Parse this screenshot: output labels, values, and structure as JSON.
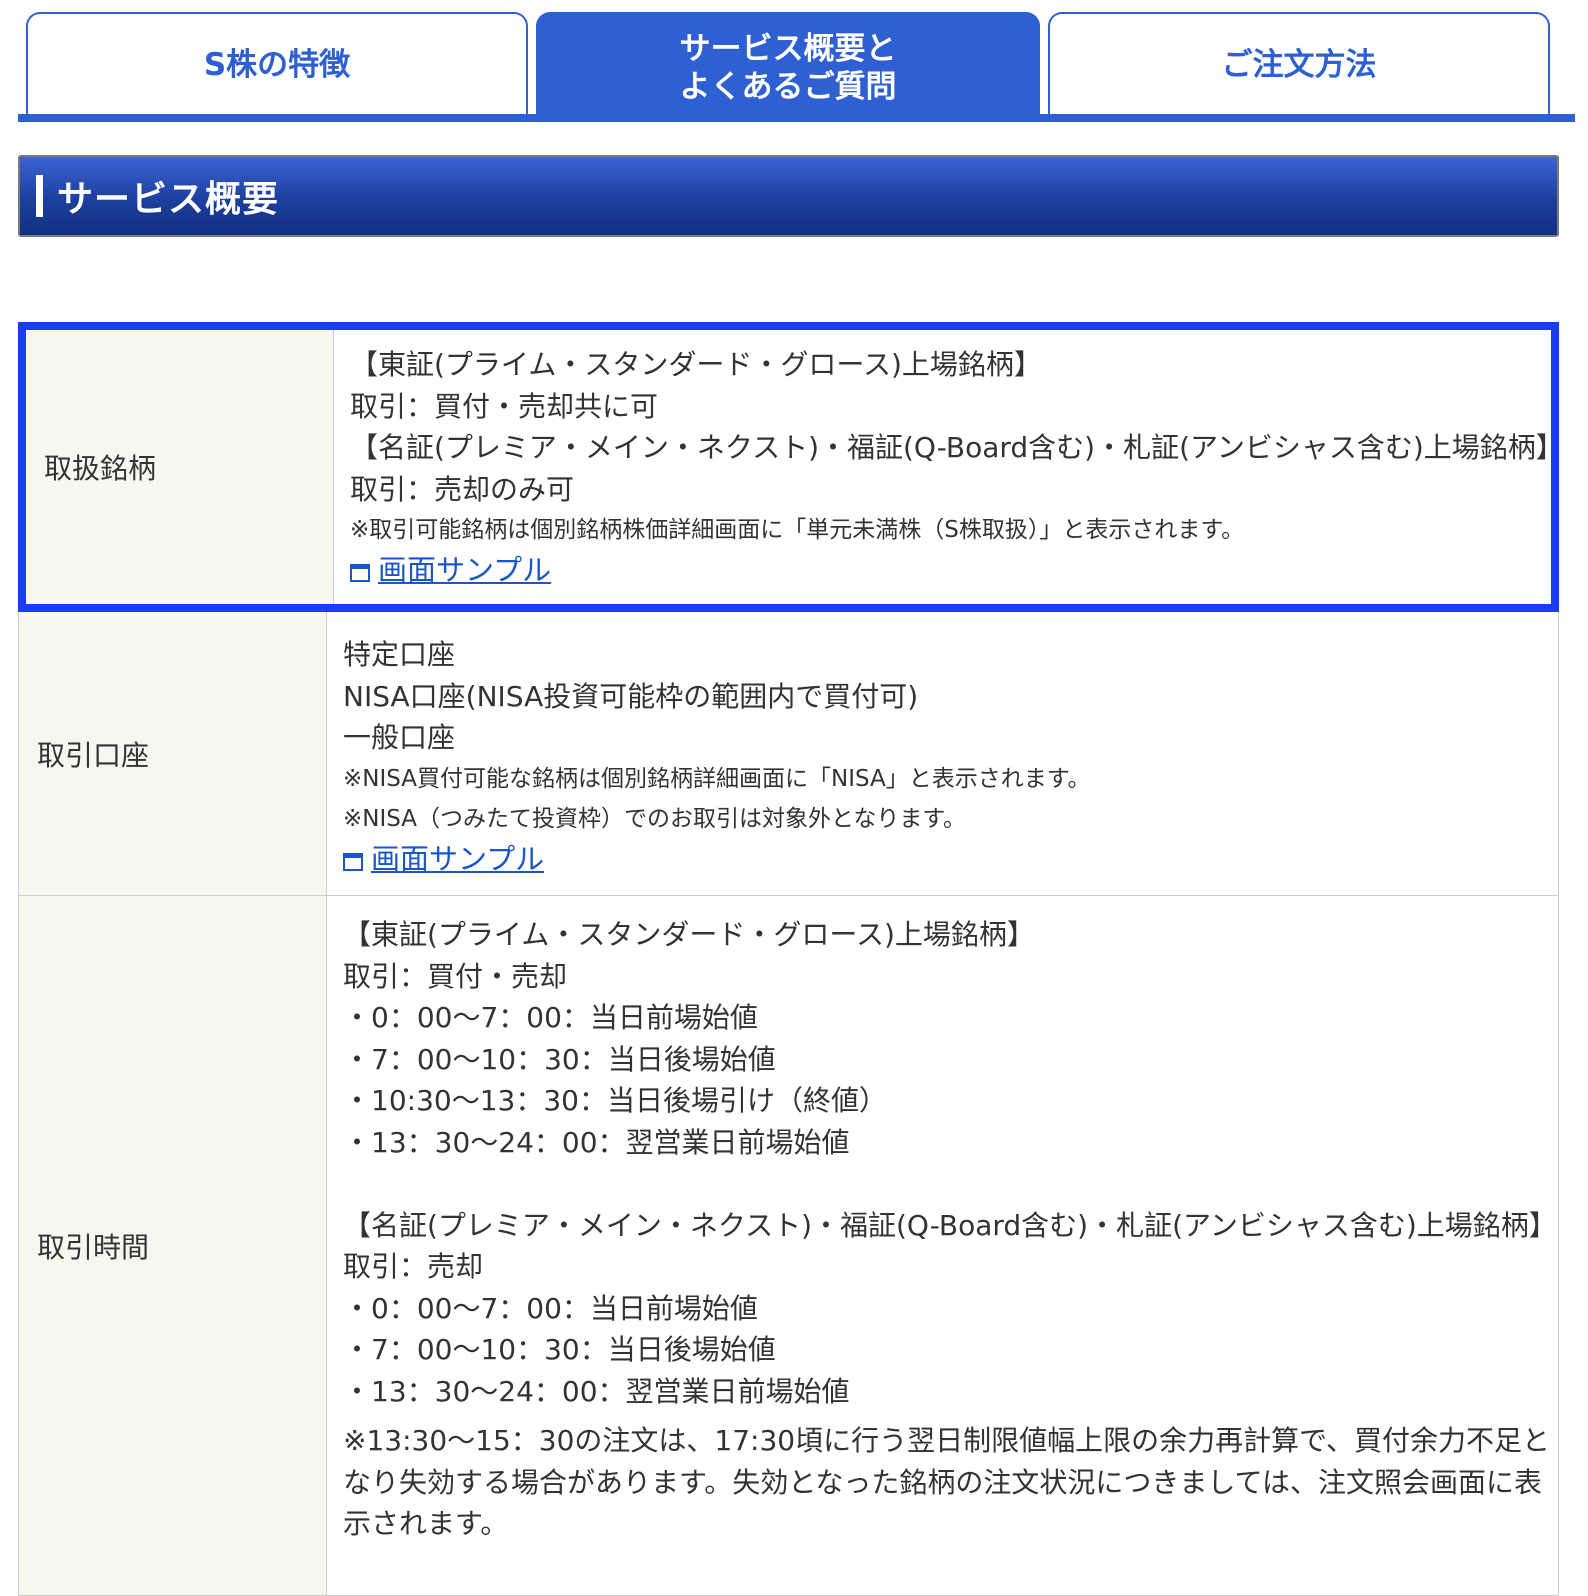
{
  "tabs": [
    {
      "label": "S株の特徴",
      "active": false
    },
    {
      "label": "サービス概要と\nよくあるご質問",
      "active": true
    },
    {
      "label": "ご注文方法",
      "active": false
    }
  ],
  "section": {
    "title": "サービス概要"
  },
  "rows": [
    {
      "label": "取扱銘柄",
      "lines": [
        "【東証(プライム・スタンダード・グロース)上場銘柄】",
        "取引：買付・売却共に可",
        "【名証(プレミア・メイン・ネクスト)・福証(Q-Board含む)・札証(アンビシャス含む)上場銘柄】",
        "取引：売却のみ可"
      ],
      "notes": [
        "※取引可能銘柄は個別銘柄株価詳細画面に「単元未満株（S株取扱）」と表示されます。"
      ],
      "link": "画面サンプル"
    },
    {
      "label": "取引口座",
      "lines": [
        "特定口座",
        "NISA口座(NISA投資可能枠の範囲内で買付可)",
        "一般口座"
      ],
      "notes": [
        "※NISA買付可能な銘柄は個別銘柄詳細画面に「NISA」と表示されます。",
        "※NISA（つみたて投資枠）でのお取引は対象外となります。"
      ],
      "link": "画面サンプル"
    },
    {
      "label": "取引時間",
      "lines": [
        "【東証(プライム・スタンダード・グロース)上場銘柄】",
        "取引：買付・売却",
        "・0：00〜7：00：当日前場始値",
        "・7：00〜10：30：当日後場始値",
        "・10:30〜13：30：当日後場引け（終値）",
        "・13：30〜24：00：翌営業日前場始値",
        "",
        "【名証(プレミア・メイン・ネクスト)・福証(Q-Board含む)・札証(アンビシャス含む)上場銘柄】",
        "取引：売却",
        "・0：00〜7：00：当日前場始値",
        "・7：00〜10：30：当日後場始値",
        "・13：30〜24：00：翌営業日前場始値"
      ],
      "paragraph": "※13:30〜15：30の注文は、17:30頃に行う翌日制限値幅上限の余力再計算で、買付余力不足となり失効する場合があります。失効となった銘柄の注文状況につきましては、注文照会画面に表示されます。"
    }
  ]
}
